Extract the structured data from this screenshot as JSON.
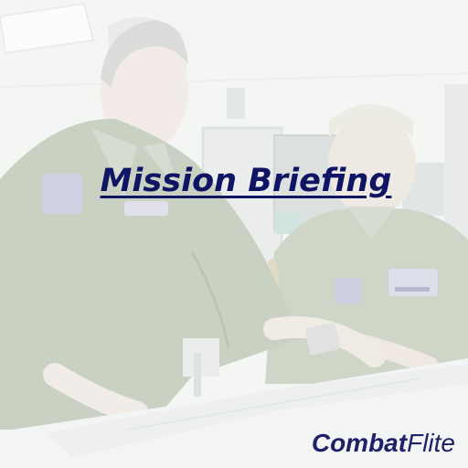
{
  "slide": {
    "title": "Mission Briefing",
    "logo_bold": "Combat",
    "logo_light": "Flite",
    "colors": {
      "title": "#0f1464",
      "logo": "#1e2168",
      "background_wash": "#f3f5f4",
      "flight_suit": "#a7b39e"
    }
  }
}
